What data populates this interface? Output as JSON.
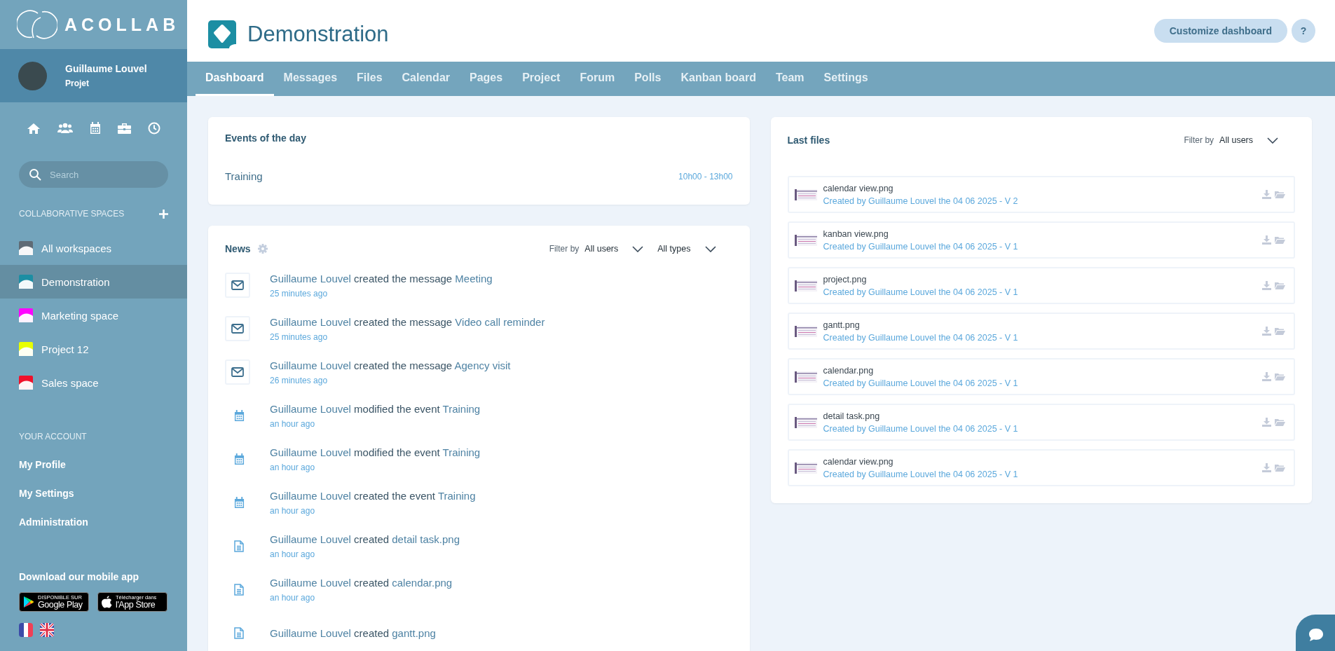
{
  "sidebar": {
    "logo": "ACOLLAB",
    "user": {
      "name": "Guillaume Louvel",
      "role": "Projet"
    },
    "search": {
      "placeholder": "Search"
    },
    "spaces_heading": "COLLABORATIVE SPACES",
    "spaces": [
      {
        "label": "All workspaces",
        "color": "#5f6b75",
        "selected": false
      },
      {
        "label": "Demonstration",
        "color": "#1c8ea3",
        "selected": true
      },
      {
        "label": "Marketing space",
        "color": "#ff00ff",
        "selected": false
      },
      {
        "label": "Project 12",
        "color": "#e8ff00",
        "selected": false
      },
      {
        "label": "Sales space",
        "color": "#f0102a",
        "selected": false
      }
    ],
    "account_heading": "YOUR ACCOUNT",
    "account_items": [
      "My Profile",
      "My Settings",
      "Administration"
    ],
    "app_heading": "Download our mobile app",
    "stores": [
      {
        "kind": "google",
        "small": "DISPONIBLE SUR",
        "big": "Google Play"
      },
      {
        "kind": "apple",
        "small": "Télécharger dans",
        "big": "l'App Store"
      }
    ],
    "languages": [
      {
        "kind": "fr"
      },
      {
        "kind": "en"
      }
    ]
  },
  "header": {
    "title": "Demonstration",
    "customize_button": "Customize dashboard",
    "help_button": "?"
  },
  "tabs": [
    {
      "label": "Dashboard",
      "selected": true
    },
    {
      "label": "Messages",
      "selected": false
    },
    {
      "label": "Files",
      "selected": false
    },
    {
      "label": "Calendar",
      "selected": false
    },
    {
      "label": "Pages",
      "selected": false
    },
    {
      "label": "Project",
      "selected": false
    },
    {
      "label": "Forum",
      "selected": false
    },
    {
      "label": "Polls",
      "selected": false
    },
    {
      "label": "Kanban board",
      "selected": false
    },
    {
      "label": "Team",
      "selected": false
    },
    {
      "label": "Settings",
      "selected": false
    }
  ],
  "events": {
    "title": "Events of the day",
    "items": [
      {
        "name": "Training",
        "time": "10h00 - 13h00"
      }
    ]
  },
  "news": {
    "title": "News",
    "filter_label": "Filter by",
    "user_filter": "All users",
    "type_filter": "All types",
    "items": [
      {
        "kind": "message",
        "actor": "Guillaume Louvel",
        "action": "created the message",
        "target": "Meeting",
        "time": "25 minutes ago"
      },
      {
        "kind": "message",
        "actor": "Guillaume Louvel",
        "action": "created the message",
        "target": "Video call reminder",
        "time": "25 minutes ago"
      },
      {
        "kind": "message",
        "actor": "Guillaume Louvel",
        "action": "created the message",
        "target": "Agency visit",
        "time": "26 minutes ago"
      },
      {
        "kind": "event",
        "actor": "Guillaume Louvel",
        "action": "modified the event",
        "target": "Training",
        "time": "an hour ago"
      },
      {
        "kind": "event",
        "actor": "Guillaume Louvel",
        "action": "modified the event",
        "target": "Training",
        "time": "an hour ago"
      },
      {
        "kind": "event",
        "actor": "Guillaume Louvel",
        "action": "created the event",
        "target": "Training",
        "time": "an hour ago"
      },
      {
        "kind": "file",
        "actor": "Guillaume Louvel",
        "action": "created",
        "target": "detail task.png",
        "time": "an hour ago"
      },
      {
        "kind": "file",
        "actor": "Guillaume Louvel",
        "action": "created",
        "target": "calendar.png",
        "time": "an hour ago"
      },
      {
        "kind": "file",
        "actor": "Guillaume Louvel",
        "action": "created",
        "target": "gantt.png"
      }
    ]
  },
  "files": {
    "title": "Last files",
    "filter_label": "Filter by",
    "user_filter": "All users",
    "items": [
      {
        "name": "calendar view.png",
        "meta": "Created by Guillaume Louvel the 04 06 2025 - V 2"
      },
      {
        "name": "kanban view.png",
        "meta": "Created by Guillaume Louvel the 04 06 2025 - V 1"
      },
      {
        "name": "project.png",
        "meta": "Created by Guillaume Louvel the 04 06 2025 - V 1"
      },
      {
        "name": "gantt.png",
        "meta": "Created by Guillaume Louvel the 04 06 2025 - V 1"
      },
      {
        "name": "calendar.png",
        "meta": "Created by Guillaume Louvel the 04 06 2025 - V 1"
      },
      {
        "name": "detail task.png",
        "meta": "Created by Guillaume Louvel the 04 06 2025 - V 1"
      },
      {
        "name": "calendar view.png",
        "meta": "Created by Guillaume Louvel the 04 06 2025 - V 1"
      }
    ]
  }
}
